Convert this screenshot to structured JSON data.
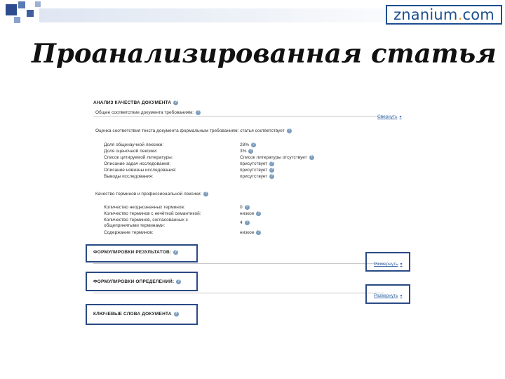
{
  "header": {
    "logo": {
      "name": "znanium",
      "dot": ".",
      "tld": "com"
    },
    "title": "Проанализированная статья"
  },
  "colors": {
    "accent": "#1d4e8f",
    "logo_dot": "#f39a1e",
    "frame": "#2a4a85",
    "link": "#3a6aa8"
  },
  "analysis": {
    "section_title": "АНАЛИЗ КАЧЕСТВА ДОКУМЕНТА",
    "general": "Общее соответствие документа требованиям:",
    "expand": "Свернуть",
    "structure_title": "Оценка соответствия текста документа формальным требованиям: статья соответствует",
    "metrics": [
      {
        "label": "Доля общенаучной лексики:",
        "value": "28%"
      },
      {
        "label": "Доля оценочной лексики:",
        "value": "3%"
      },
      {
        "label": "Список цитируемой литературы:",
        "value": "Список литературы отсутствует"
      },
      {
        "label": "Описание задач исследования:",
        "value": "присутствует"
      },
      {
        "label": "Описание новизны исследования:",
        "value": "присутствует"
      },
      {
        "label": "Выводы исследования:",
        "value": "присутствует"
      }
    ],
    "vocab_title": "Качество терминов и профессиональной лексики:",
    "vocab": [
      {
        "label": "Количество неоднозначных терминов:",
        "value": "0"
      },
      {
        "label": "Количество терминов с нечёткой семантикой:",
        "value": "низкое"
      },
      {
        "label": "Количество терминов, согласованных с",
        "label2": "общепринятыми терминами:",
        "value": "4"
      },
      {
        "label": "Содержание терминов:",
        "value": "низкое"
      }
    ]
  },
  "sections": [
    {
      "title": "ФОРМУЛИРОВКИ РЕЗУЛЬТАТОВ:",
      "link": "Развернуть"
    },
    {
      "title": "ФОРМУЛИРОВКИ ОПРЕДЕЛЕНИЙ:",
      "link": "Развернуть"
    },
    {
      "title": "КЛЮЧЕВЫЕ СЛОВА ДОКУМЕНТА",
      "link": ""
    }
  ],
  "icons": {
    "help": "help-icon",
    "arrow": "chevron-down-icon"
  }
}
